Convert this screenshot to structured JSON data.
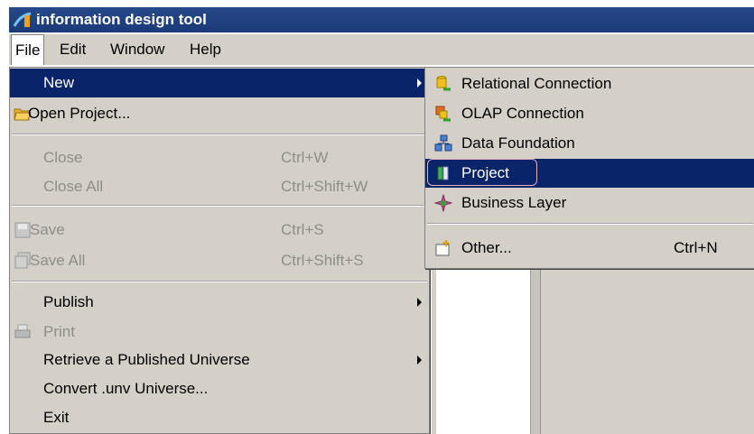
{
  "title_bar": {
    "title": "information design tool"
  },
  "menubar": {
    "items": [
      "File",
      "Edit",
      "Window",
      "Help"
    ]
  },
  "file_menu": {
    "new": "New",
    "open_project": "Open Project...",
    "close": "Close",
    "close_shortcut": "Ctrl+W",
    "close_all": "Close All",
    "close_all_shortcut": "Ctrl+Shift+W",
    "save": "Save",
    "save_shortcut": "Ctrl+S",
    "save_all": "Save All",
    "save_all_shortcut": "Ctrl+Shift+S",
    "publish": "Publish",
    "print": "Print",
    "retrieve": "Retrieve a Published Universe",
    "convert": "Convert .unv Universe...",
    "exit": "Exit"
  },
  "new_submenu": {
    "relational_connection": "Relational Connection",
    "olap_connection": "OLAP Connection",
    "data_foundation": "Data Foundation",
    "project": "Project",
    "business_layer": "Business Layer",
    "other": "Other...",
    "other_shortcut": "Ctrl+N"
  },
  "colors": {
    "highlight": "#0a246a",
    "menu_bg": "#d4d0c8",
    "title_bg": "#1c3a78",
    "disabled": "#8f8d86"
  }
}
